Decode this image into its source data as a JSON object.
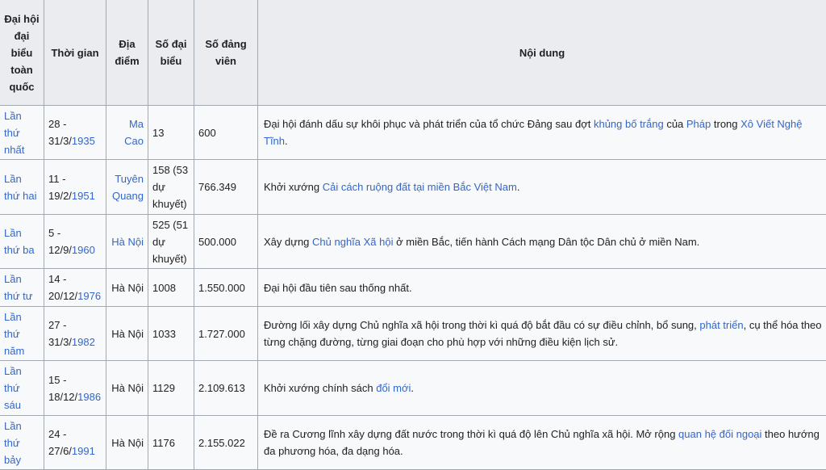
{
  "headers": {
    "dai_hoi": "Đại hội đại biểu toàn quốc",
    "thoi_gian": "Thời gian",
    "dia_diem": "Địa điểm",
    "so_dai_bieu": "Số đại biểu",
    "so_dang_vien": "Số đảng viên",
    "noi_dung": "Nội dung"
  },
  "rows": [
    {
      "dai_hoi": "Lần thứ nhất",
      "time_pre": "28 - 31/3/",
      "year": "1935",
      "place": "Ma Cao",
      "place_link": true,
      "delegates": "13",
      "members": "600",
      "content": [
        {
          "t": "Đại hội đánh dấu sự khôi phục và phát triển của tổ chức Đảng sau đợt "
        },
        {
          "t": "khủng bố trắng",
          "link": true
        },
        {
          "t": " của "
        },
        {
          "t": "Pháp",
          "link": true
        },
        {
          "t": " trong "
        },
        {
          "t": "Xô Viết Nghệ Tĩnh",
          "link": true
        },
        {
          "t": "."
        }
      ]
    },
    {
      "dai_hoi": "Lần thứ hai",
      "time_pre": "11 - 19/2/",
      "year": "1951",
      "place": "Tuyên Quang",
      "place_link": true,
      "delegates": "158 (53 dự khuyết)",
      "members": "766.349",
      "content": [
        {
          "t": "Khởi xướng "
        },
        {
          "t": "Cải cách ruộng đất tại miền Bắc Việt Nam",
          "link": true
        },
        {
          "t": "."
        }
      ]
    },
    {
      "dai_hoi": "Lần thứ ba",
      "time_pre": "5 - 12/9/",
      "year": "1960",
      "place": "Hà Nội",
      "place_link": true,
      "delegates": "525 (51 dự khuyết)",
      "members": "500.000",
      "content": [
        {
          "t": "Xây dựng "
        },
        {
          "t": "Chủ nghĩa Xã hội",
          "link": true
        },
        {
          "t": " ở miền Bắc, tiến hành Cách mạng Dân tộc Dân chủ ở miền Nam."
        }
      ]
    },
    {
      "dai_hoi": "Lần thứ tư",
      "time_pre": "14 - 20/12/",
      "year": "1976",
      "place": "Hà Nội",
      "place_link": false,
      "delegates": "1008",
      "members": "1.550.000",
      "content": [
        {
          "t": "Đại hội đầu tiên sau thống nhất."
        }
      ]
    },
    {
      "dai_hoi": "Lần thứ năm",
      "time_pre": "27 - 31/3/",
      "year": "1982",
      "place": "Hà Nội",
      "place_link": false,
      "delegates": "1033",
      "members": "1.727.000",
      "content": [
        {
          "t": "Đường lối xây dựng Chủ nghĩa xã hội trong thời kì quá độ bắt đầu có sự điều chỉnh, bổ sung, "
        },
        {
          "t": "phát triển",
          "link": true
        },
        {
          "t": ", cụ thể hóa theo từng chặng đường, từng giai đoạn cho phù hợp với những điều kiện lịch sử."
        }
      ]
    },
    {
      "dai_hoi": "Lần thứ sáu",
      "time_pre": "15 - 18/12/",
      "year": "1986",
      "place": "Hà Nội",
      "place_link": false,
      "delegates": "1129",
      "members": "2.109.613",
      "content": [
        {
          "t": "Khởi xướng chính sách "
        },
        {
          "t": "đổi mới",
          "link": true
        },
        {
          "t": "."
        }
      ]
    },
    {
      "dai_hoi": "Lần thứ bảy",
      "time_pre": "24 - 27/6/",
      "year": "1991",
      "place": "Hà Nội",
      "place_link": false,
      "delegates": "1176",
      "members": "2.155.022",
      "content": [
        {
          "t": "Đề ra Cương lĩnh xây dựng đất nước trong thời kì quá độ lên Chủ nghĩa xã hội. Mở rộng "
        },
        {
          "t": "quan hệ đối ngoại",
          "link": true
        },
        {
          "t": " theo hướng đa phương hóa, đa dạng hóa."
        }
      ]
    }
  ]
}
